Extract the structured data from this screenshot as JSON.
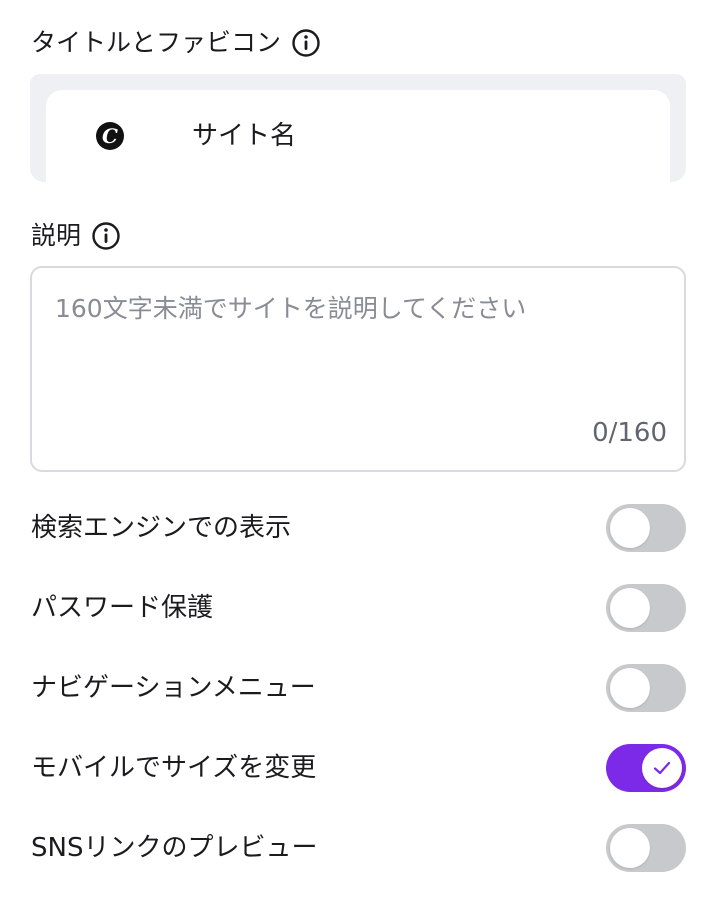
{
  "title_section": {
    "label": "タイトルとファビコン",
    "info_icon": "info-icon",
    "favicon_letter": "C",
    "site_name": "サイト名"
  },
  "description": {
    "label": "説明",
    "info_icon": "info-icon",
    "placeholder": "160文字未満でサイトを説明してください",
    "counter": "0/160"
  },
  "settings": [
    {
      "label": "検索エンジンでの表示",
      "enabled": false
    },
    {
      "label": "パスワード保護",
      "enabled": false
    },
    {
      "label": "ナビゲーションメニュー",
      "enabled": false
    },
    {
      "label": "モバイルでサイズを変更",
      "enabled": true
    },
    {
      "label": "SNSリンクのプレビュー",
      "enabled": false
    }
  ],
  "colors": {
    "accent": "#7d2ae8",
    "toggle_off": "#c8c9cd",
    "border": "#d9dadf",
    "preview_bg": "#eff0f4"
  }
}
